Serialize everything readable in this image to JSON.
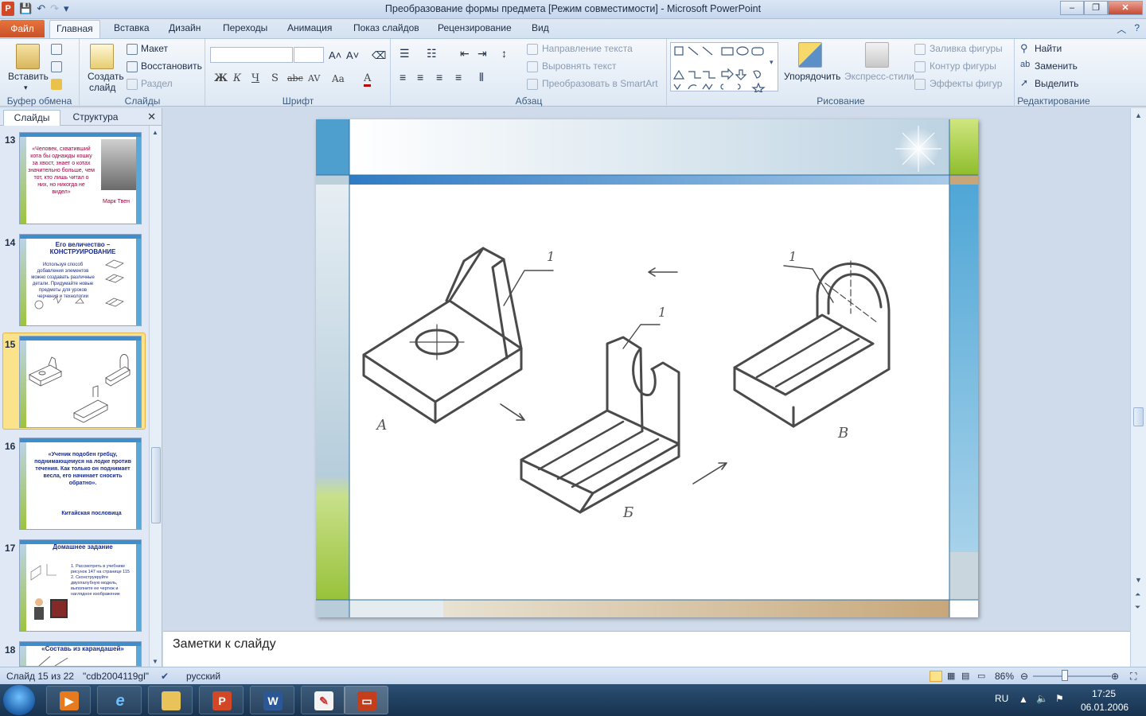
{
  "window": {
    "title": "Преобразование формы предмета [Режим совместимости]  -  Microsoft PowerPoint",
    "buttons": [
      "–",
      "❐",
      "✕"
    ]
  },
  "tabs": {
    "file": "Файл",
    "items": [
      "Главная",
      "Вставка",
      "Дизайн",
      "Переходы",
      "Анимация",
      "Показ слайдов",
      "Рецензирование",
      "Вид"
    ],
    "active": "Главная"
  },
  "ribbon": {
    "clipboard": {
      "paste": "Вставить",
      "label": "Буфер обмена"
    },
    "slides": {
      "new_slide_line1": "Создать",
      "new_slide_line2": "слайд",
      "layout": "Макет",
      "reset": "Восстановить",
      "section": "Раздел",
      "label": "Слайды"
    },
    "font": {
      "label": "Шрифт",
      "bold": "Ж",
      "italic": "К",
      "underline": "Ч",
      "shadow": "S",
      "strike": "abc",
      "spacing": "AV",
      "case": "Aa",
      "color": "A"
    },
    "paragraph": {
      "text_direction": "Направление текста",
      "align_text": "Выровнять текст",
      "smartart": "Преобразовать в SmartArt",
      "label": "Абзац"
    },
    "drawing": {
      "arrange": "Упорядочить",
      "quick_styles": "Экспресс-стили",
      "fill": "Заливка фигуры",
      "outline": "Контур фигуры",
      "effects": "Эффекты фигур",
      "label": "Рисование"
    },
    "editing": {
      "find": "Найти",
      "replace": "Заменить",
      "select": "Выделить",
      "label": "Редактирование"
    }
  },
  "panel": {
    "tab_slides": "Слайды",
    "tab_outline": "Структура",
    "close": "✕",
    "thumbs": [
      {
        "num": "13",
        "text": "«Человек, схвативший кота бы однажды кошку за хвост, знает о котах значительно больше, чем тот, кто лишь читал о них, но никогда не видел»",
        "author": "Марк Твен"
      },
      {
        "num": "14",
        "title": "Его величество – КОНСТРУИРОВАНИЕ",
        "text": "Используя способ добавления элементов можно создавать различные детали. Придумайте новые предметы для уроков черчения и технологии"
      },
      {
        "num": "15"
      },
      {
        "num": "16",
        "text": "«Ученик подобен гребцу, поднимающемуся на лодке против течения. Как только он поднимает весла, его начинает сносить обратно».",
        "author": "Китайская пословица"
      },
      {
        "num": "17",
        "title": "Домашнее задание",
        "text": "1. Рассмотреть в учебнике рисунок 147 на странице 115 2. Сконструируйте двухпалубную модель, выполните ее чертеж и наглядное изображение"
      },
      {
        "num": "18",
        "title": "«Составь из карандашей»"
      }
    ],
    "selected": "15"
  },
  "slide": {
    "labels": {
      "a": "А",
      "b": "Б",
      "v": "В",
      "callout_a": "1",
      "callout_b": "1",
      "callout_v": "1"
    }
  },
  "notes": {
    "placeholder": "Заметки к слайду"
  },
  "status": {
    "slide": "Слайд 15 из 22",
    "theme": "\"cdb2004119gl\"",
    "language": "русский",
    "zoom": "86%"
  },
  "taskbar": {
    "lang": "RU",
    "time": "17:25",
    "date": "06.01.2006"
  },
  "colors": {
    "accent_blue": "#3d8ecb",
    "accent_green": "#9cc33b",
    "accent_tan": "#c7a77a",
    "file_tab": "#d24726"
  }
}
